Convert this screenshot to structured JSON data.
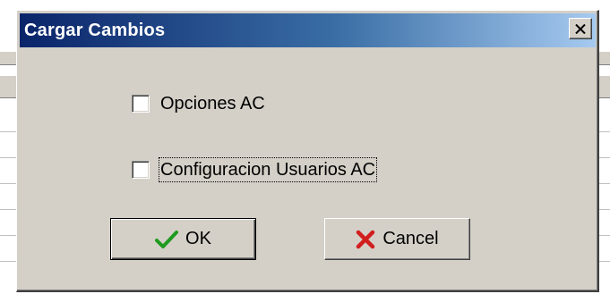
{
  "dialog": {
    "title": "Cargar Cambios",
    "close_icon": "close-icon"
  },
  "options": [
    {
      "label": "Opciones AC",
      "checked": false
    },
    {
      "label": "Configuracion Usuarios AC",
      "checked": false
    }
  ],
  "buttons": {
    "ok_label": "OK",
    "ok_icon": "checkmark-icon",
    "ok_icon_color": "#1f9a1f",
    "cancel_label": "Cancel",
    "cancel_icon": "x-icon",
    "cancel_icon_color": "#d21e1e"
  },
  "colors": {
    "titlebar_start": "#0a246a",
    "titlebar_end": "#a6caf0",
    "dialog_face": "#d4d0c8"
  }
}
